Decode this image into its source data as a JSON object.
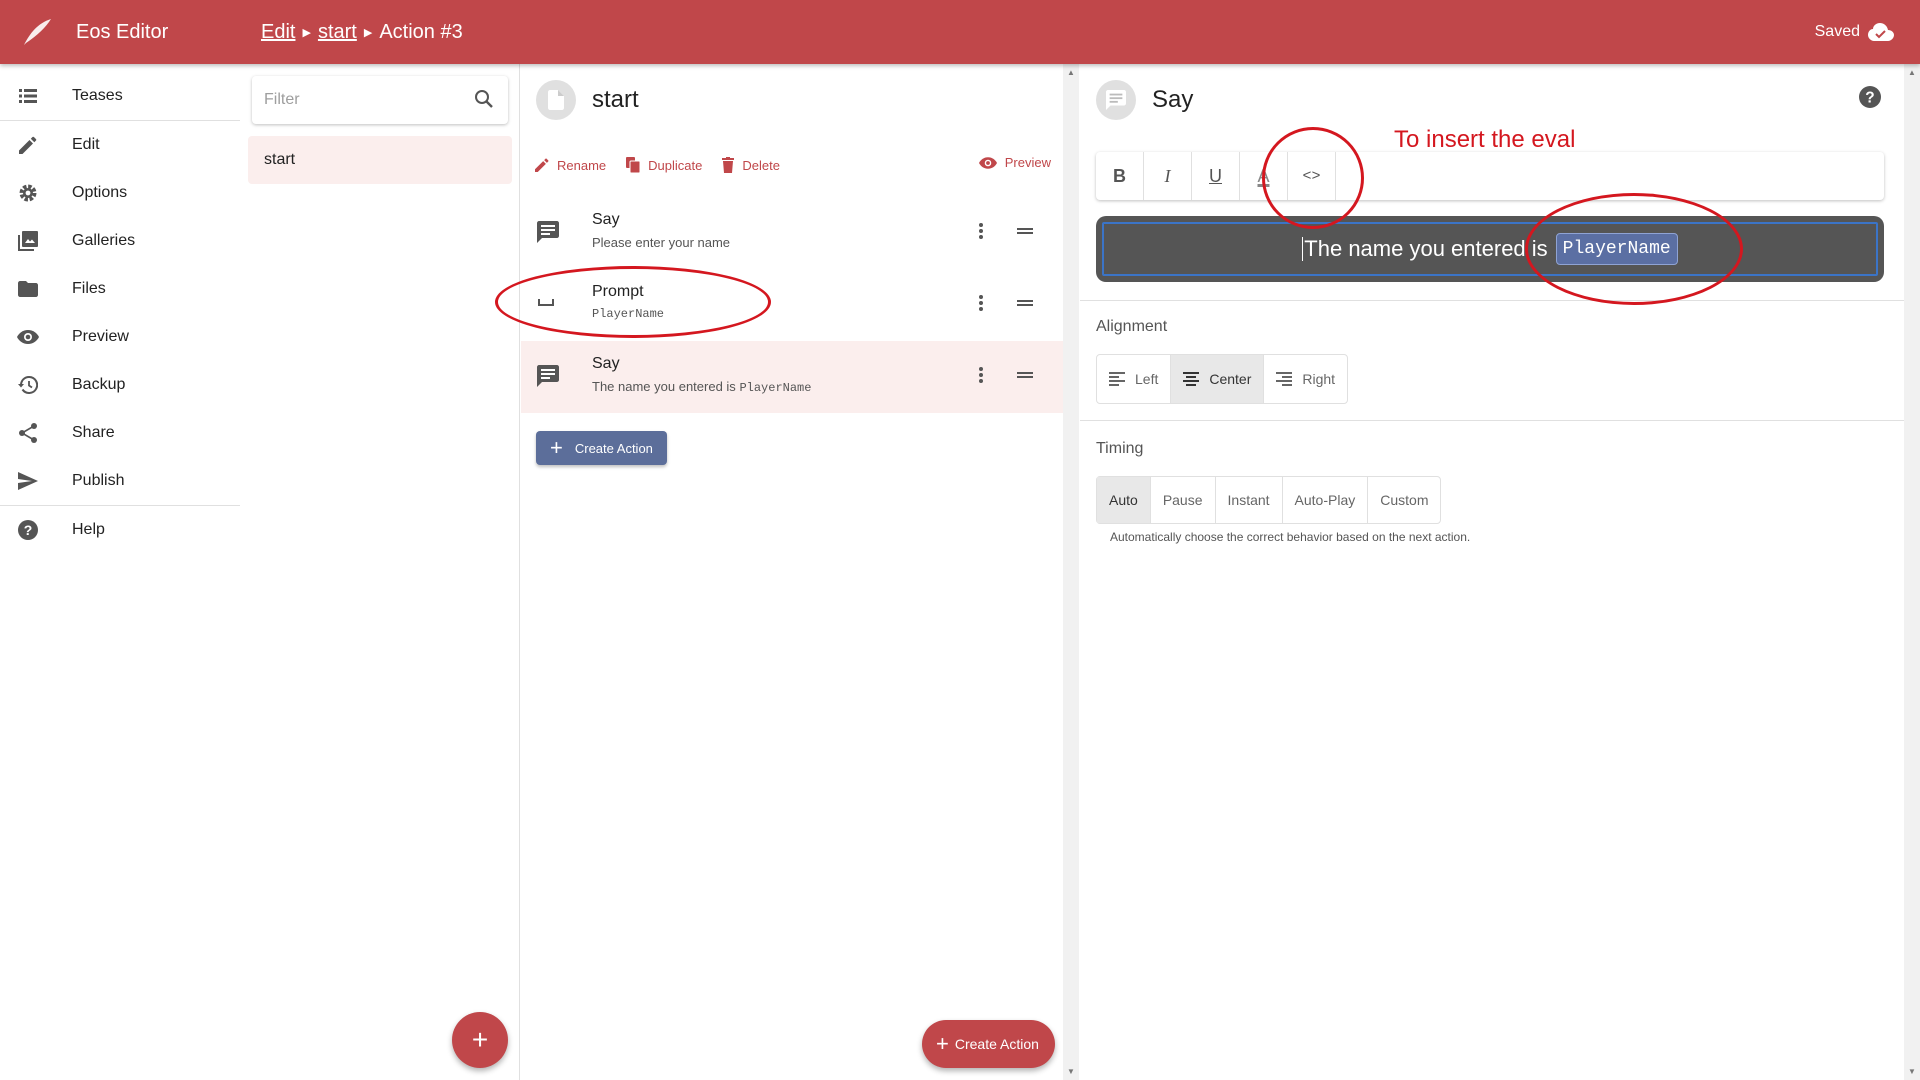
{
  "header": {
    "app_title": "Eos Editor",
    "breadcrumbs": [
      "Edit",
      "start",
      "Action #3"
    ],
    "status": "Saved"
  },
  "nav": {
    "items": [
      {
        "label": "Teases",
        "icon": "list-icon"
      },
      {
        "label": "Edit",
        "icon": "pencil-icon"
      },
      {
        "label": "Options",
        "icon": "gear-icon"
      },
      {
        "label": "Galleries",
        "icon": "gallery-icon"
      },
      {
        "label": "Files",
        "icon": "folder-icon"
      },
      {
        "label": "Preview",
        "icon": "eye-icon"
      },
      {
        "label": "Backup",
        "icon": "history-icon"
      },
      {
        "label": "Share",
        "icon": "share-icon"
      },
      {
        "label": "Publish",
        "icon": "send-icon"
      },
      {
        "label": "Help",
        "icon": "help-icon"
      }
    ]
  },
  "pages": {
    "filter_placeholder": "Filter",
    "items": [
      "start"
    ],
    "fab_label": "+"
  },
  "actions": {
    "page_name": "start",
    "toolbar": {
      "rename": "Rename",
      "duplicate": "Duplicate",
      "delete": "Delete",
      "preview": "Preview"
    },
    "list": [
      {
        "title": "Say",
        "subtitle": "Please enter your name"
      },
      {
        "title": "Prompt",
        "subtitle": "PlayerName"
      },
      {
        "title": "Say",
        "subtitle_prefix": "The name you entered is",
        "subtitle_code": "PlayerName"
      }
    ],
    "create_button": "Create Action",
    "fab_label": "Create Action"
  },
  "editor": {
    "title": "Say",
    "format_buttons": [
      "B",
      "I",
      "U",
      "A",
      "<>"
    ],
    "text_prefix": "The name you entered is",
    "eval_chip": "PlayerName",
    "alignment": {
      "label": "Alignment",
      "options": [
        "Left",
        "Center",
        "Right"
      ],
      "selected": "Center"
    },
    "timing": {
      "label": "Timing",
      "options": [
        "Auto",
        "Pause",
        "Instant",
        "Auto-Play",
        "Custom"
      ],
      "selected": "Auto",
      "hint": "Automatically choose the correct behavior based on the next action."
    }
  },
  "annotation": {
    "text": "To insert the eval",
    "color": "#d4171f"
  },
  "colors": {
    "primary": "#c0474a",
    "secondary": "#5c6e9a",
    "selected_row": "#fbeeed"
  }
}
